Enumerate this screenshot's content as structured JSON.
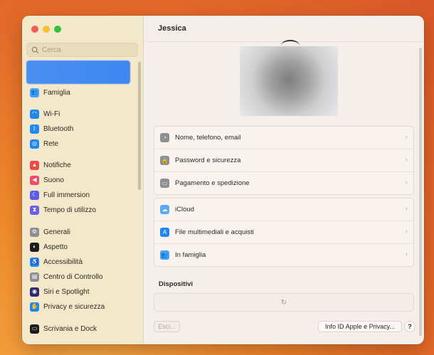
{
  "search": {
    "placeholder": "Cerca"
  },
  "sidebar": {
    "items": [
      {
        "label": "Famiglia",
        "icon": "family-icon",
        "color": "#4aa3f0",
        "glyph": "👥"
      },
      {
        "label": "Wi-Fi",
        "icon": "wifi-icon",
        "color": "#1e88ef",
        "glyph": "◠"
      },
      {
        "label": "Bluetooth",
        "icon": "bluetooth-icon",
        "color": "#1e88ef",
        "glyph": "ᛒ"
      },
      {
        "label": "Rete",
        "icon": "network-icon",
        "color": "#1e88ef",
        "glyph": "◎"
      },
      {
        "label": "Notifiche",
        "icon": "bell-icon",
        "color": "#ef4a4a",
        "glyph": "▲"
      },
      {
        "label": "Suono",
        "icon": "speaker-icon",
        "color": "#ef4a6a",
        "glyph": "◀"
      },
      {
        "label": "Full immersion",
        "icon": "moon-icon",
        "color": "#5e5ce6",
        "glyph": "☾"
      },
      {
        "label": "Tempo di utilizzo",
        "icon": "hourglass-icon",
        "color": "#6d5ce6",
        "glyph": "⧗"
      },
      {
        "label": "Generali",
        "icon": "gear-icon",
        "color": "#8e8e93",
        "glyph": "⚙"
      },
      {
        "label": "Aspetto",
        "icon": "appearance-icon",
        "color": "#1c1c1e",
        "glyph": "◐"
      },
      {
        "label": "Accessibilità",
        "icon": "accessibility-icon",
        "color": "#1e88ef",
        "glyph": "♿"
      },
      {
        "label": "Centro di Controllo",
        "icon": "control-center-icon",
        "color": "#8e8e93",
        "glyph": "▤"
      },
      {
        "label": "Siri e Spotlight",
        "icon": "siri-icon",
        "color": "#2b2b6e",
        "glyph": "◉"
      },
      {
        "label": "Privacy e sicurezza",
        "icon": "hand-icon",
        "color": "#1e88ef",
        "glyph": "✋"
      },
      {
        "label": "Scrivania e Dock",
        "icon": "dock-icon",
        "color": "#1c1c1e",
        "glyph": "▭"
      }
    ]
  },
  "header": {
    "title": "Jessica"
  },
  "groups": [
    [
      {
        "label": "Nome, telefono, email",
        "icon": "person-icon",
        "color": "#8e8e93",
        "glyph": "◔"
      },
      {
        "label": "Password e sicurezza",
        "icon": "lock-icon",
        "color": "#8e8e93",
        "glyph": "🔒"
      },
      {
        "label": "Pagamento e spedizione",
        "icon": "card-icon",
        "color": "#8e8e93",
        "glyph": "▭"
      }
    ],
    [
      {
        "label": "iCloud",
        "icon": "cloud-icon",
        "color": "#5aa9f5",
        "glyph": "☁"
      },
      {
        "label": "File multimediali e acquisti",
        "icon": "app-store-icon",
        "color": "#1e88ef",
        "glyph": "A"
      },
      {
        "label": "In famiglia",
        "icon": "family-sharing-icon",
        "color": "#4aa3f0",
        "glyph": "👥"
      }
    ]
  ],
  "devices": {
    "title": "Dispositivi"
  },
  "buttons": {
    "esci": "Esci...",
    "info": "Info ID Apple e Privacy...",
    "help": "?"
  }
}
